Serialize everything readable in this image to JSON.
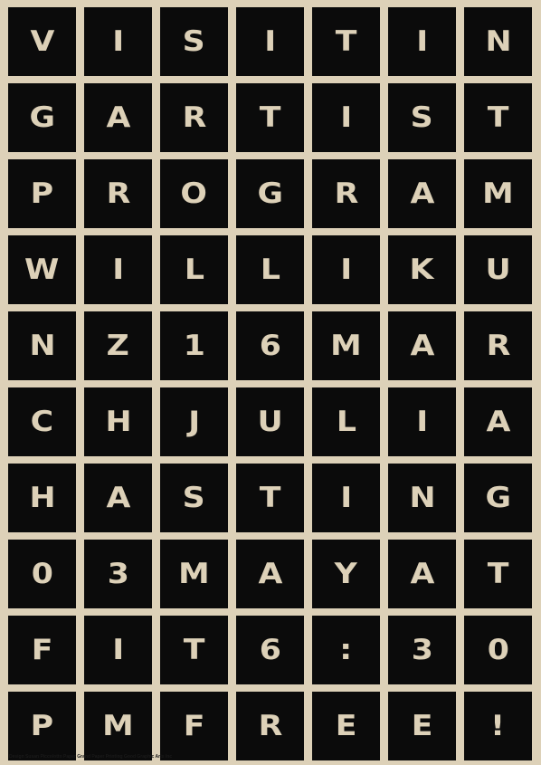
{
  "poster": {
    "rows": [
      [
        "V",
        "I",
        "S",
        "I",
        "T",
        "I",
        "N"
      ],
      [
        "G",
        "A",
        "R",
        "T",
        "I",
        "S",
        "T"
      ],
      [
        "P",
        "R",
        "O",
        "G",
        "R",
        "A",
        "M"
      ],
      [
        "W",
        "I",
        "L",
        "L",
        "I",
        "K",
        "U"
      ],
      [
        "N",
        "Z",
        "1",
        "6",
        "M",
        "A",
        "R"
      ],
      [
        "C",
        "H",
        "J",
        "U",
        "L",
        "I",
        "A"
      ],
      [
        "H",
        "A",
        "S",
        "T",
        "I",
        "N",
        "G"
      ],
      [
        "0",
        "3",
        "M",
        "A",
        "Y",
        "A",
        "T"
      ],
      [
        "F",
        "I",
        "T",
        "6",
        ":",
        "3",
        "0"
      ],
      [
        "P",
        "M",
        "F",
        "R",
        "E",
        "E",
        "!"
      ]
    ],
    "credit": "Design Susan Piccolotto   Paper Grand Paper   Printing Good Graphic Arts Inc"
  },
  "colors": {
    "background": "#ddd1b8",
    "tile": "#0b0b0b",
    "letter": "#ddd1b8"
  }
}
